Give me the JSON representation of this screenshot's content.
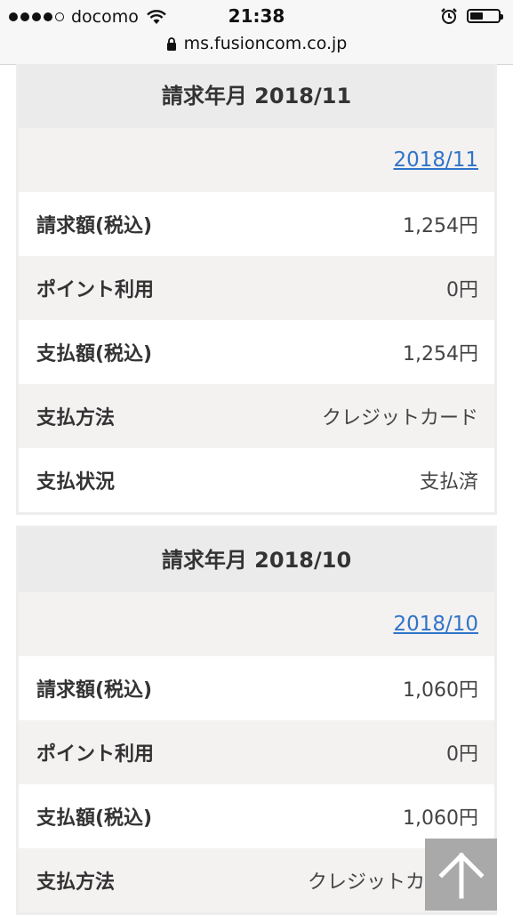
{
  "status_bar": {
    "carrier": "docomo",
    "time": "21:38",
    "url": "ms.fusioncom.co.jp",
    "signal_bars": 4,
    "signal_total": 5,
    "battery_level": 0.45,
    "icons": [
      "signal-icon",
      "wifi-icon",
      "alarm-icon",
      "battery-icon",
      "lock-icon"
    ]
  },
  "cards": [
    {
      "header": "請求年月 2018/11",
      "link": "2018/11",
      "rows": [
        {
          "label": "請求額(税込)",
          "value": "1,254円"
        },
        {
          "label": "ポイント利用",
          "value": "0円"
        },
        {
          "label": "支払額(税込)",
          "value": "1,254円"
        },
        {
          "label": "支払方法",
          "value": "クレジットカード"
        },
        {
          "label": "支払状況",
          "value": "支払済"
        }
      ]
    },
    {
      "header": "請求年月 2018/10",
      "link": "2018/10",
      "rows": [
        {
          "label": "請求額(税込)",
          "value": "1,060円"
        },
        {
          "label": "ポイント利用",
          "value": "0円"
        },
        {
          "label": "支払額(税込)",
          "value": "1,060円"
        },
        {
          "label": "支払方法",
          "value": "クレジットカ"
        }
      ]
    }
  ],
  "scroll_top_icon": "arrow-up-icon"
}
